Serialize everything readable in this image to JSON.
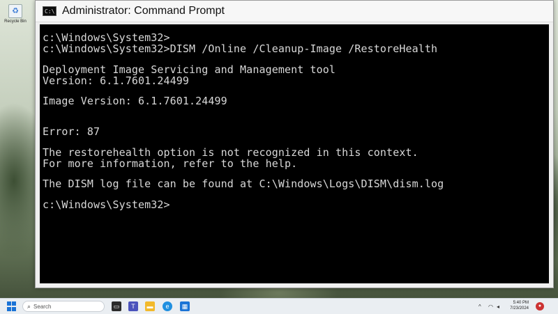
{
  "desktop": {
    "recycle_bin_label": "Recycle Bin"
  },
  "window": {
    "title": "Administrator: Command Prompt",
    "icon_text": "C:\\"
  },
  "console": {
    "lines": [
      "c:\\Windows\\System32>",
      "c:\\Windows\\System32>DISM /Online /Cleanup-Image /RestoreHealth",
      "Deployment Image Servicing and Management tool",
      "Version: 6.1.7601.24499",
      "Image Version: 6.1.7601.24499",
      "Error: 87",
      "The restorehealth option is not recognized in this context.",
      "For more information, refer to the help.",
      "The DISM log file can be found at C:\\Windows\\Logs\\DISM\\dism.log",
      "c:\\Windows\\System32>"
    ]
  },
  "taskbar": {
    "search_placeholder": "Search",
    "time": "5:40 PM",
    "date": "7/23/2024"
  }
}
